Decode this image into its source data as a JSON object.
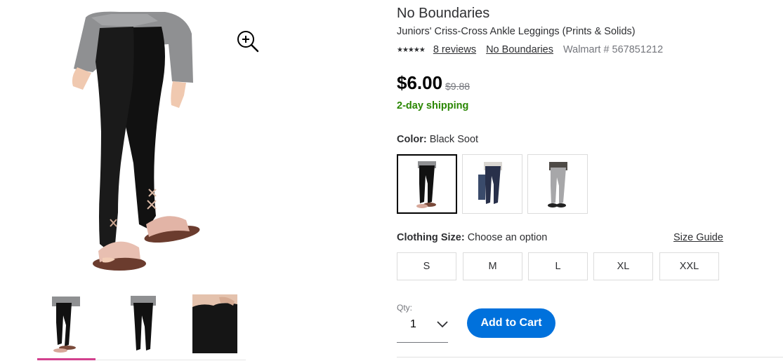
{
  "product": {
    "brand": "No Boundaries",
    "name": "Juniors' Criss-Cross Ankle Leggings (Prints & Solids)",
    "rating_stars": "★★★★★",
    "rating_value": 4.5,
    "reviews_link": "8 reviews",
    "brand_link": "No Boundaries",
    "walmart_number": "Walmart # 567851212",
    "price": "$6.00",
    "was_price": "$9.88",
    "shipping": "2-day shipping"
  },
  "gallery": {
    "main_image": "model-wearing-black-leggings-with-pink-slides",
    "zoom_icon": "zoom-in-icon",
    "thumbnails": [
      {
        "image": "black-leggings-front",
        "selected": true
      },
      {
        "image": "black-leggings-back",
        "selected": false
      },
      {
        "image": "waistband-detail",
        "selected": false
      }
    ],
    "active_color": "#d23f8d"
  },
  "color": {
    "label": "Color:",
    "value": "Black Soot",
    "swatches": [
      {
        "image": "black-leggings-swatch",
        "selected": true
      },
      {
        "image": "navy-leggings-swatch",
        "selected": false
      },
      {
        "image": "gray-leggings-swatch",
        "selected": false
      }
    ]
  },
  "size": {
    "label": "Clothing Size:",
    "value": "Choose an option",
    "guide_link": "Size Guide",
    "options": [
      "S",
      "M",
      "L",
      "XL",
      "XXL"
    ]
  },
  "quantity": {
    "label": "Qty:",
    "value": "1",
    "icon": "chevron-down-icon"
  },
  "cart": {
    "button": "Add to Cart",
    "color": "#0071dc"
  }
}
